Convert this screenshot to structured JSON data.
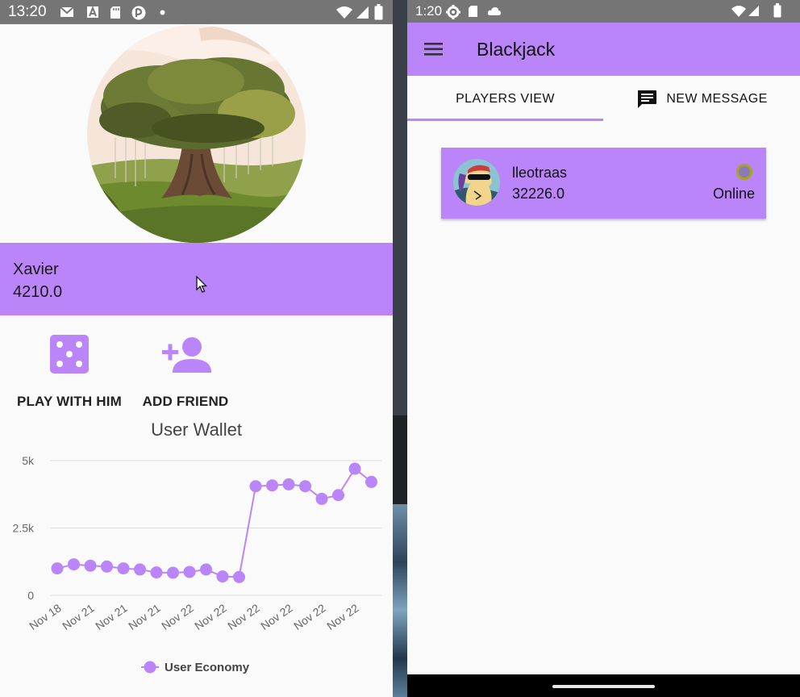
{
  "left_phone": {
    "status_bar": {
      "time": "13:20"
    },
    "profile": {
      "name": "Xavier",
      "balance": "4210.0"
    },
    "actions": [
      {
        "label": "PLAY WITH HIM",
        "icon": "dice-icon"
      },
      {
        "label": "ADD FRIEND",
        "icon": "person-add-icon"
      }
    ],
    "chart_title": "User Wallet"
  },
  "right_phone": {
    "status_bar": {
      "time": "1:20"
    },
    "app_title": "Blackjack",
    "tabs": [
      {
        "label": "PLAYERS VIEW",
        "selected": true
      },
      {
        "label": "NEW MESSAGE",
        "icon": "message-icon",
        "selected": false
      }
    ],
    "players": [
      {
        "name": "lleotraas",
        "balance": "32226.0",
        "status": "Online"
      }
    ]
  },
  "colors": {
    "accent": "#b985f9",
    "status_bar": "#757575",
    "online_ring": "#a5a61a"
  },
  "chart_data": {
    "type": "line",
    "title": "User Wallet",
    "x": [
      "Nov 18",
      "",
      "Nov 21",
      "",
      "Nov 21",
      "",
      "Nov 21",
      "",
      "Nov 22",
      "",
      "Nov 22",
      "",
      "Nov 22",
      "",
      "Nov 22",
      "",
      "Nov 22",
      "",
      "Nov 22",
      ""
    ],
    "x_tick_labels": [
      "Nov 18",
      "Nov 21",
      "Nov 21",
      "Nov 21",
      "Nov 22",
      "Nov 22",
      "Nov 22",
      "Nov 22",
      "Nov 22",
      "Nov 22"
    ],
    "series": [
      {
        "name": "User Economy",
        "values": [
          1000,
          1150,
          1100,
          1070,
          1000,
          960,
          850,
          840,
          870,
          960,
          700,
          680,
          4050,
          4080,
          4120,
          4050,
          3580,
          3720,
          4700,
          4210
        ]
      }
    ],
    "y_ticks": [
      "0",
      "2.5k",
      "5k"
    ],
    "ylim": [
      0,
      5000
    ],
    "grid": true,
    "legend": "bottom-center"
  }
}
